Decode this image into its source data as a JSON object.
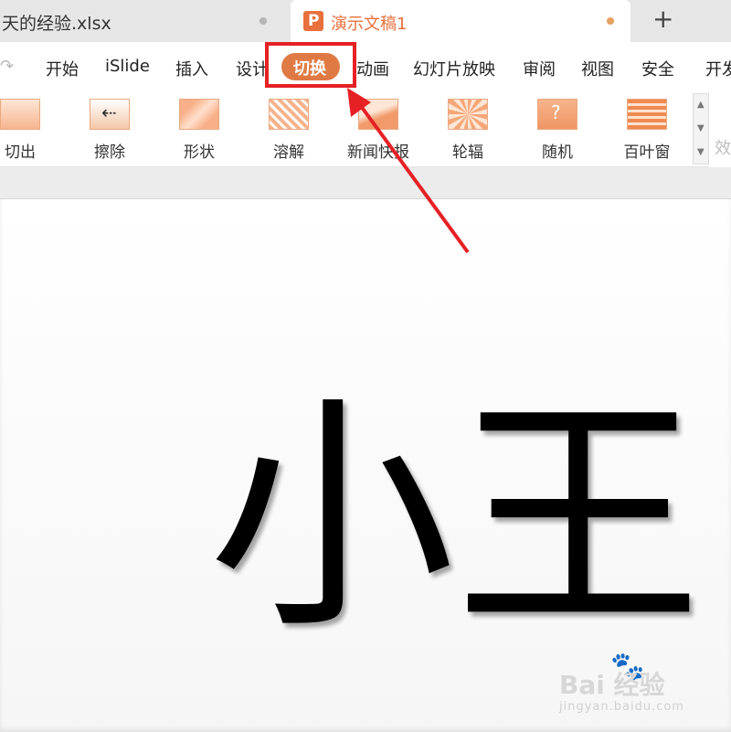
{
  "tabs": [
    {
      "title": "天的经验.xlsx"
    },
    {
      "title": "演示文稿1",
      "icon": "ppt-icon",
      "icon_letter": "P"
    }
  ],
  "new_tab_label": "+",
  "redo_icon": "↷",
  "menu": {
    "items": [
      "开始",
      "iSlide",
      "插入",
      "设计",
      "切换",
      "动画",
      "幻灯片放映",
      "审阅",
      "视图",
      "安全",
      "开发"
    ],
    "active": "切换",
    "accent": "#e07a45"
  },
  "ribbon": {
    "effects": [
      {
        "label": "切出",
        "icon": "cut-out-thumb"
      },
      {
        "label": "擦除",
        "icon": "wipe-thumb",
        "glyph": "⇠"
      },
      {
        "label": "形状",
        "icon": "shape-thumb"
      },
      {
        "label": "溶解",
        "icon": "dissolve-thumb"
      },
      {
        "label": "新闻快报",
        "icon": "newsflash-thumb"
      },
      {
        "label": "轮辐",
        "icon": "wheel-thumb"
      },
      {
        "label": "随机",
        "icon": "random-thumb",
        "glyph": "?"
      },
      {
        "label": "百叶窗",
        "icon": "blinds-thumb"
      }
    ],
    "effect_options_label": "效"
  },
  "slide": {
    "text": "小王"
  },
  "annotation_color": "#e52125",
  "watermark": {
    "text": "Bai 经验",
    "url": "jingyan.baidu.com"
  }
}
